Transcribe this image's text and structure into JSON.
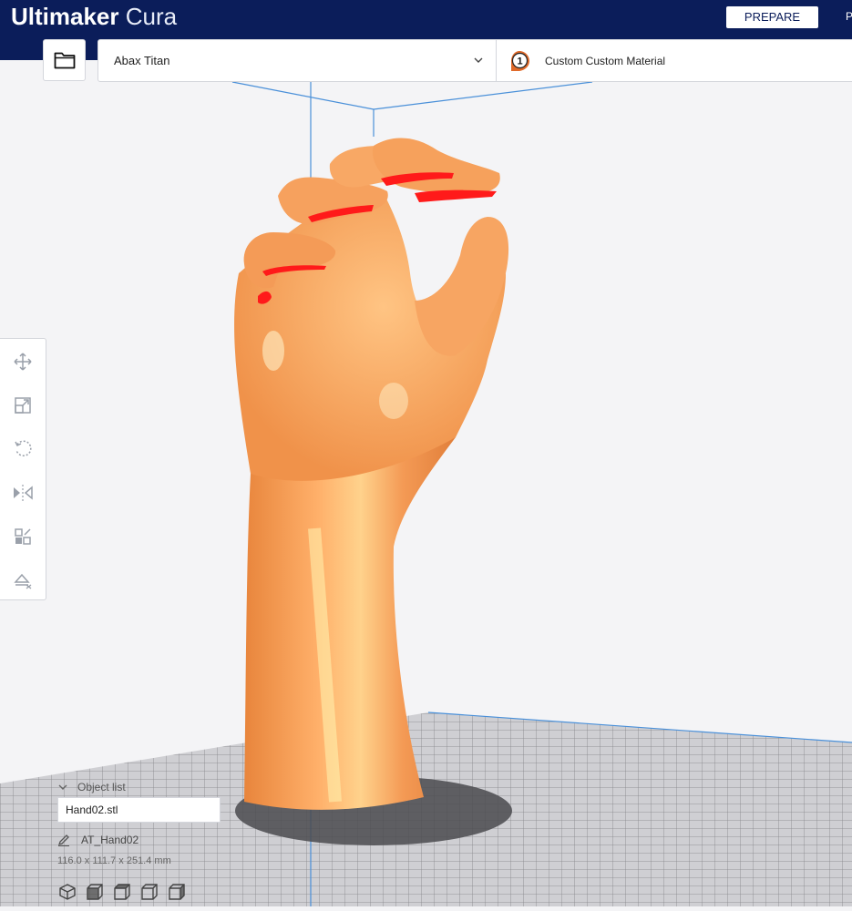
{
  "app": {
    "brand_bold": "Ultimaker",
    "brand_light": "Cura"
  },
  "header": {
    "stage_active": "PREPARE",
    "stage_next_partial": "P"
  },
  "toolbar": {
    "open_icon": "folder-icon",
    "printer": "Abax Titan",
    "extruder_number": "1",
    "material": "Custom Custom Material"
  },
  "tools": [
    {
      "name": "move-icon"
    },
    {
      "name": "scale-icon"
    },
    {
      "name": "rotate-icon"
    },
    {
      "name": "mirror-icon"
    },
    {
      "name": "per-model-settings-icon"
    },
    {
      "name": "support-blocker-icon"
    }
  ],
  "object_list": {
    "header": "Object list",
    "file": "Hand02.stl",
    "job_name": "AT_Hand02",
    "dimensions": "116.0 x 111.7 x 251.4 mm"
  },
  "view_buttons": [
    "3d-view-icon",
    "front-view-icon",
    "top-view-icon",
    "left-view-icon",
    "right-view-icon"
  ],
  "colors": {
    "header_bg": "#0b1d5a",
    "model": "#f5a261",
    "overhang": "#ff1a1a",
    "build_volume_line": "#4a90d9"
  }
}
